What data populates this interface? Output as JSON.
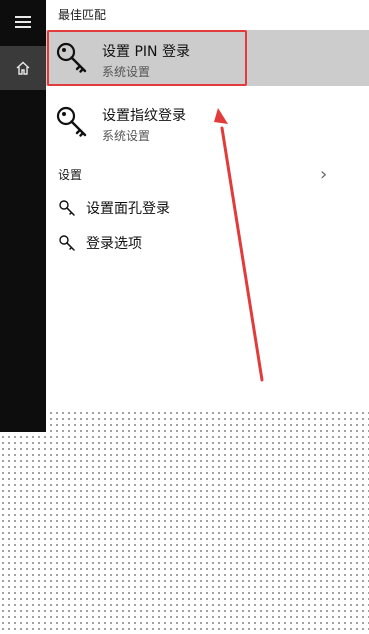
{
  "rail": {
    "menu_icon": "hamburger-icon",
    "home_icon": "home-icon"
  },
  "best_match": {
    "title": "最佳匹配",
    "items": [
      {
        "title": "设置 PIN 登录",
        "subtitle": "系统设置",
        "icon": "key-icon",
        "selected": true
      },
      {
        "title": "设置指纹登录",
        "subtitle": "系统设置",
        "icon": "key-icon",
        "selected": false
      }
    ]
  },
  "settings": {
    "title": "设置",
    "items": [
      {
        "label": "设置面孔登录",
        "icon": "key-icon"
      },
      {
        "label": "登录选项",
        "icon": "key-icon"
      }
    ]
  },
  "colors": {
    "rail_bg": "#0d0d0d",
    "rail_active": "#3a3a3a",
    "selection_bg": "#cccccc",
    "annotation_red": "#e23b3b"
  }
}
